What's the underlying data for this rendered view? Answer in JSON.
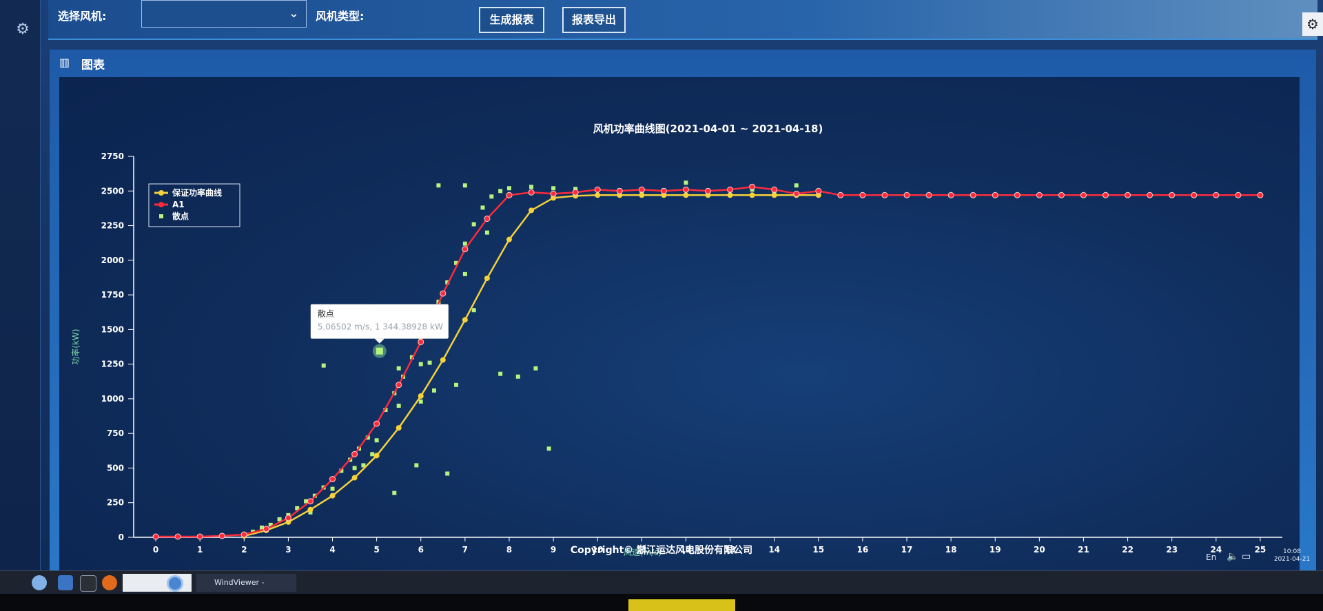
{
  "toolbar": {
    "select_turbine_label": "选择风机:",
    "turbine_type_label": "风机类型:",
    "generate_report_label": "生成报表",
    "export_report_label": "报表导出"
  },
  "panel": {
    "title": "图表"
  },
  "footer": {
    "copyright": "Copyright© 浙江运达风电股份有限公司"
  },
  "tray": {
    "language": "En",
    "time": "10:08",
    "date": "2021-04-21"
  },
  "taskbar": {
    "window_label": "WindViewer - Chromium"
  },
  "colors": {
    "guarantee_curve": "#f5d13a",
    "a1_curve": "#ff2a3a",
    "scatter": "#b6f27d",
    "axis": "#ffffff"
  },
  "tooltip": {
    "title": "散点",
    "value": "5.06502 m/s, 1 344.38928 kW",
    "x": 5.06502,
    "y": 1344.38928
  },
  "chart_data": {
    "type": "line",
    "title": "风机功率曲线图(2021-04-01 ~ 2021-04-18)",
    "xlabel": "风速(m/s)",
    "ylabel": "功率(kW)",
    "xlim": [
      -0.5,
      25.5
    ],
    "ylim": [
      0,
      2750
    ],
    "xticks": [
      0,
      1,
      2,
      3,
      4,
      5,
      6,
      7,
      8,
      9,
      10,
      11,
      12,
      13,
      14,
      15,
      16,
      17,
      18,
      19,
      20,
      21,
      22,
      23,
      24,
      25
    ],
    "yticks": [
      0,
      250,
      500,
      750,
      1000,
      1250,
      1500,
      1750,
      2000,
      2250,
      2500,
      2750
    ],
    "legend_position": "top-left",
    "legend": [
      "保证功率曲线",
      "A1",
      "散点"
    ],
    "series": [
      {
        "name": "保证功率曲线",
        "type": "line",
        "points": [
          [
            2,
            10
          ],
          [
            2.5,
            50
          ],
          [
            3,
            110
          ],
          [
            3.5,
            200
          ],
          [
            4,
            300
          ],
          [
            4.5,
            430
          ],
          [
            5,
            590
          ],
          [
            5.5,
            790
          ],
          [
            6,
            1020
          ],
          [
            6.5,
            1280
          ],
          [
            7,
            1570
          ],
          [
            7.5,
            1870
          ],
          [
            8,
            2150
          ],
          [
            8.5,
            2360
          ],
          [
            9,
            2450
          ],
          [
            9.5,
            2465
          ],
          [
            10,
            2470
          ],
          [
            10.5,
            2470
          ],
          [
            11,
            2470
          ],
          [
            11.5,
            2470
          ],
          [
            12,
            2470
          ],
          [
            12.5,
            2470
          ],
          [
            13,
            2470
          ],
          [
            13.5,
            2470
          ],
          [
            14,
            2470
          ],
          [
            14.5,
            2470
          ],
          [
            15,
            2470
          ]
        ]
      },
      {
        "name": "A1",
        "type": "line",
        "points": [
          [
            0,
            5
          ],
          [
            0.5,
            5
          ],
          [
            1,
            5
          ],
          [
            1.5,
            10
          ],
          [
            2,
            20
          ],
          [
            2.5,
            60
          ],
          [
            3,
            140
          ],
          [
            3.5,
            260
          ],
          [
            4,
            420
          ],
          [
            4.5,
            600
          ],
          [
            5,
            820
          ],
          [
            5.5,
            1100
          ],
          [
            6,
            1410
          ],
          [
            6.5,
            1760
          ],
          [
            7,
            2080
          ],
          [
            7.5,
            2300
          ],
          [
            8,
            2470
          ],
          [
            8.5,
            2490
          ],
          [
            9,
            2480
          ],
          [
            9.5,
            2490
          ],
          [
            10,
            2510
          ],
          [
            10.5,
            2500
          ],
          [
            11,
            2510
          ],
          [
            11.5,
            2500
          ],
          [
            12,
            2510
          ],
          [
            12.5,
            2500
          ],
          [
            13,
            2510
          ],
          [
            13.5,
            2530
          ],
          [
            14,
            2510
          ],
          [
            14.5,
            2480
          ],
          [
            15,
            2500
          ],
          [
            15.5,
            2470
          ],
          [
            16,
            2470
          ],
          [
            16.5,
            2470
          ],
          [
            17,
            2470
          ],
          [
            17.5,
            2470
          ],
          [
            18,
            2470
          ],
          [
            18.5,
            2470
          ],
          [
            19,
            2470
          ],
          [
            19.5,
            2470
          ],
          [
            20,
            2470
          ],
          [
            20.5,
            2470
          ],
          [
            21,
            2470
          ],
          [
            21.5,
            2470
          ],
          [
            22,
            2470
          ],
          [
            22.5,
            2470
          ],
          [
            23,
            2470
          ],
          [
            23.5,
            2470
          ],
          [
            24,
            2470
          ],
          [
            24.5,
            2470
          ],
          [
            25,
            2470
          ]
        ]
      },
      {
        "name": "散点",
        "type": "scatter",
        "points": [
          [
            2.0,
            20
          ],
          [
            2.2,
            40
          ],
          [
            2.4,
            70
          ],
          [
            2.6,
            90
          ],
          [
            2.8,
            130
          ],
          [
            3.0,
            160
          ],
          [
            3.2,
            210
          ],
          [
            3.4,
            260
          ],
          [
            3.6,
            300
          ],
          [
            3.8,
            360
          ],
          [
            4.0,
            420
          ],
          [
            4.2,
            480
          ],
          [
            4.4,
            560
          ],
          [
            4.6,
            640
          ],
          [
            4.8,
            720
          ],
          [
            5.0,
            820
          ],
          [
            5.2,
            920
          ],
          [
            5.4,
            1040
          ],
          [
            5.6,
            1160
          ],
          [
            5.8,
            1300
          ],
          [
            6.0,
            1420
          ],
          [
            6.2,
            1560
          ],
          [
            6.4,
            1700
          ],
          [
            6.6,
            1840
          ],
          [
            6.8,
            1980
          ],
          [
            7.0,
            2120
          ],
          [
            7.2,
            2260
          ],
          [
            7.4,
            2380
          ],
          [
            7.6,
            2460
          ],
          [
            7.8,
            2500
          ],
          [
            8.0,
            2520
          ],
          [
            8.5,
            2530
          ],
          [
            9.0,
            2520
          ],
          [
            9.5,
            2515
          ],
          [
            10.0,
            2510
          ],
          [
            10.5,
            2505
          ],
          [
            11.0,
            2500
          ],
          [
            11.5,
            2505
          ],
          [
            12.0,
            2510
          ],
          [
            12.5,
            2500
          ],
          [
            13.0,
            2505
          ],
          [
            13.5,
            2510
          ],
          [
            14.0,
            2500
          ],
          [
            3.0,
            120
          ],
          [
            3.5,
            180
          ],
          [
            4.0,
            350
          ],
          [
            4.5,
            500
          ],
          [
            5.0,
            700
          ],
          [
            5.5,
            950
          ],
          [
            6.0,
            1250
          ],
          [
            6.5,
            1550
          ],
          [
            7.0,
            1900
          ],
          [
            7.5,
            2200
          ],
          [
            6.6,
            460
          ],
          [
            7.8,
            1180
          ],
          [
            8.2,
            1160
          ],
          [
            8.6,
            1220
          ],
          [
            8.9,
            640
          ],
          [
            5.5,
            1220
          ],
          [
            6.2,
            1260
          ],
          [
            6.8,
            1100
          ],
          [
            7.2,
            1640
          ],
          [
            7.0,
            2540
          ],
          [
            3.8,
            1240
          ],
          [
            6.3,
            1060
          ],
          [
            6.0,
            980
          ],
          [
            4.7,
            520
          ],
          [
            5.9,
            520
          ],
          [
            5.4,
            320
          ],
          [
            4.9,
            600
          ],
          [
            14.5,
            2540
          ],
          [
            6.4,
            2540
          ],
          [
            12.0,
            2560
          ]
        ]
      }
    ]
  }
}
